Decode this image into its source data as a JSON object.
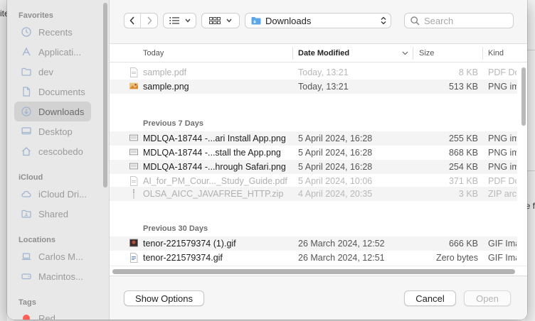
{
  "background": {
    "left_fragment": "ite",
    "right_fragment": "e f"
  },
  "sidebar": {
    "favorites_title": "Favorites",
    "favorites": [
      {
        "label": "Recents",
        "icon": "clock-icon"
      },
      {
        "label": "Applicati...",
        "icon": "applications-icon"
      },
      {
        "label": "dev",
        "icon": "folder-icon"
      },
      {
        "label": "Documents",
        "icon": "document-icon"
      },
      {
        "label": "Downloads",
        "icon": "download-icon",
        "selected": true
      },
      {
        "label": "Desktop",
        "icon": "desktop-icon"
      },
      {
        "label": "cescobedo",
        "icon": "home-icon"
      }
    ],
    "icloud_title": "iCloud",
    "icloud": [
      {
        "label": "iCloud Dri...",
        "icon": "cloud-icon"
      },
      {
        "label": "Shared",
        "icon": "shared-folder-icon"
      }
    ],
    "locations_title": "Locations",
    "locations": [
      {
        "label": "Carlos M...",
        "icon": "laptop-icon"
      },
      {
        "label": "Macintos...",
        "icon": "disk-icon"
      }
    ],
    "tags_title": "Tags",
    "tags": [
      {
        "label": "Red",
        "color": "#ff5f57"
      }
    ]
  },
  "toolbar": {
    "path": "Downloads",
    "search_placeholder": "Search"
  },
  "columns": {
    "name": "Today",
    "date": "Date Modified",
    "size": "Size",
    "kind": "Kind"
  },
  "groups": [
    {
      "title": "",
      "files": [
        {
          "name": "sample.pdf",
          "date": "Today, 13:21",
          "size": "8 KB",
          "kind": "PDF Doc",
          "dim": true,
          "icon": "pdf"
        },
        {
          "name": "sample.png",
          "date": "Today, 13:21",
          "size": "513 KB",
          "kind": "PNG ima",
          "dim": false,
          "icon": "image-color"
        }
      ]
    },
    {
      "title": "Previous 7 Days",
      "files": [
        {
          "name": "MDLQA-18744 -...ari Install App.png",
          "date": "5 April 2024, 16:28",
          "size": "255 KB",
          "kind": "PNG ima",
          "dim": false,
          "icon": "screenshot"
        },
        {
          "name": "MDLQA-18744 -...stall the App.png",
          "date": "5 April 2024, 16:28",
          "size": "868 KB",
          "kind": "PNG ima",
          "dim": false,
          "icon": "screenshot"
        },
        {
          "name": "MDLQA-18744 -...hrough Safari.png",
          "date": "5 April 2024, 16:28",
          "size": "254 KB",
          "kind": "PNG ima",
          "dim": false,
          "icon": "screenshot"
        },
        {
          "name": "AI_for_PM_Cour..._Study_Guide.pdf",
          "date": "5 April 2024, 10:06",
          "size": "371 KB",
          "kind": "PDF Doc",
          "dim": true,
          "icon": "pdf"
        },
        {
          "name": "OLSA_AICC_JAVAFREE_HTTP.zip",
          "date": "4 April 2024, 20:35",
          "size": "3 KB",
          "kind": "ZIP arc",
          "dim": true,
          "icon": "zip"
        }
      ]
    },
    {
      "title": "Previous 30 Days",
      "files": [
        {
          "name": "tenor-221579374 (1).gif",
          "date": "26 March 2024, 12:52",
          "size": "666 KB",
          "kind": "GIF Ima",
          "dim": false,
          "icon": "image-dark"
        },
        {
          "name": "tenor-221579374.gif",
          "date": "26 March 2024, 12:51",
          "size": "Zero bytes",
          "kind": "GIF Ima",
          "dim": false,
          "icon": "doc"
        }
      ]
    }
  ],
  "footer": {
    "options_label": "Show Options",
    "cancel_label": "Cancel",
    "open_label": "Open"
  }
}
